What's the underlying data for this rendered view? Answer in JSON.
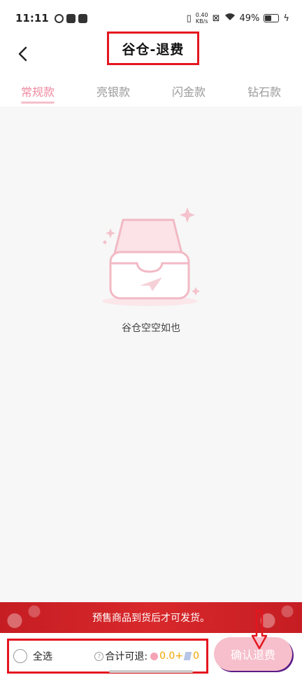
{
  "status": {
    "time": "11:11",
    "net_speed_value": "0.40",
    "net_speed_unit": "KB/s",
    "battery": "49%"
  },
  "header": {
    "title": "谷仓-退费"
  },
  "tabs": [
    {
      "label": "常规款",
      "active": true
    },
    {
      "label": "亮银款",
      "active": false
    },
    {
      "label": "闪金款",
      "active": false
    },
    {
      "label": "钻石款",
      "active": false
    }
  ],
  "empty": {
    "text": "谷仓空空如也"
  },
  "banner": {
    "text": "预售商品到货后才可发货。"
  },
  "footer": {
    "select_all": "全选",
    "total_label": "合计可退:",
    "coin_amount": "0.0+",
    "gem_amount": "0",
    "confirm": "确认退费"
  },
  "colors": {
    "accent": "#f08aa0",
    "annotation": "#e4161e",
    "banner": "#d8282b"
  }
}
